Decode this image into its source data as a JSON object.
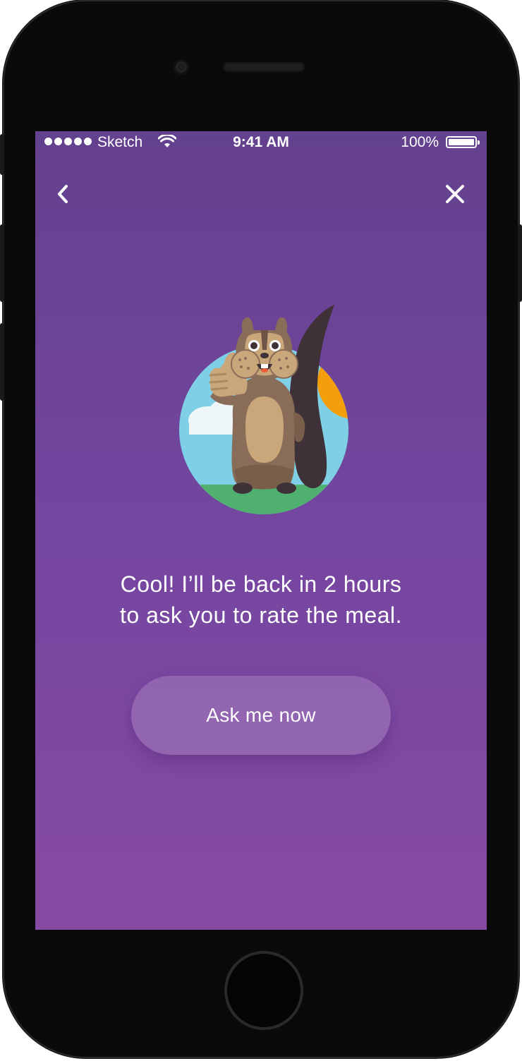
{
  "status_bar": {
    "carrier": "Sketch",
    "time": "9:41 AM",
    "battery": "100%",
    "signal_icon": "signal-dots-icon",
    "wifi_icon": "wifi-icon",
    "battery_icon": "battery-icon"
  },
  "nav": {
    "back_icon": "chevron-left-icon",
    "close_icon": "close-icon"
  },
  "illustration": {
    "icon": "squirrel-thumbs-up-illustration"
  },
  "message": {
    "line1": "Cool! I’ll be back in 2 hours",
    "line2": "to ask you to rate the meal."
  },
  "actions": {
    "ask_now_label": "Ask me now"
  },
  "colors": {
    "background_top": "#64418e",
    "background_bottom": "#874aa3",
    "sky": "#7fd0e6",
    "grass": "#4fb070",
    "sun": "#f59e0b",
    "fur": "#8a6d58",
    "belly": "#c9a77a"
  }
}
